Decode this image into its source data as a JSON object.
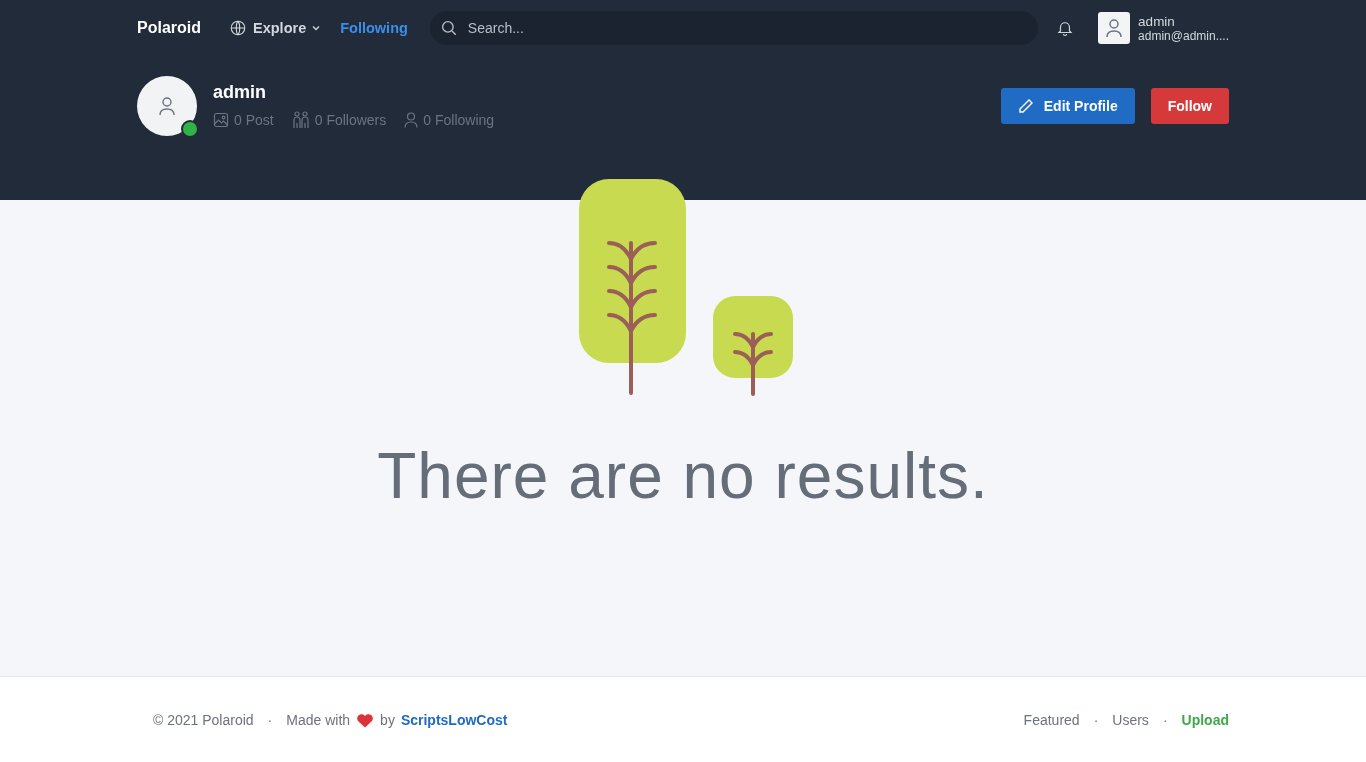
{
  "navbar": {
    "brand": "Polaroid",
    "items": [
      {
        "label": "Explore",
        "kind": "dropdown",
        "selected": false
      },
      {
        "label": "Following",
        "kind": "link",
        "selected": true
      }
    ],
    "search": {
      "placeholder": "Search..."
    },
    "user": {
      "name": "admin",
      "email": "admin@admin...."
    }
  },
  "profile": {
    "name": "admin",
    "online": true,
    "stats": [
      {
        "kind": "posts",
        "label": "0 Post"
      },
      {
        "kind": "followers",
        "label": "0 Followers"
      },
      {
        "kind": "following",
        "label": "0 Following"
      }
    ],
    "buttons": [
      {
        "kind": "edit",
        "label": "Edit Profile"
      },
      {
        "kind": "follow",
        "label": "Follow"
      }
    ]
  },
  "empty_state": {
    "message": "There are no results."
  },
  "footer": {
    "copyright": "© 2021 Polaroid",
    "separator": "·",
    "made_with": "Made with",
    "by": "by",
    "author": "ScriptsLowCost",
    "links": [
      {
        "label": "Featured",
        "color": "#6b7280"
      },
      {
        "label": "Users",
        "color": "#6b7280"
      },
      {
        "label": "Upload",
        "color": "#3fa84a"
      }
    ]
  }
}
